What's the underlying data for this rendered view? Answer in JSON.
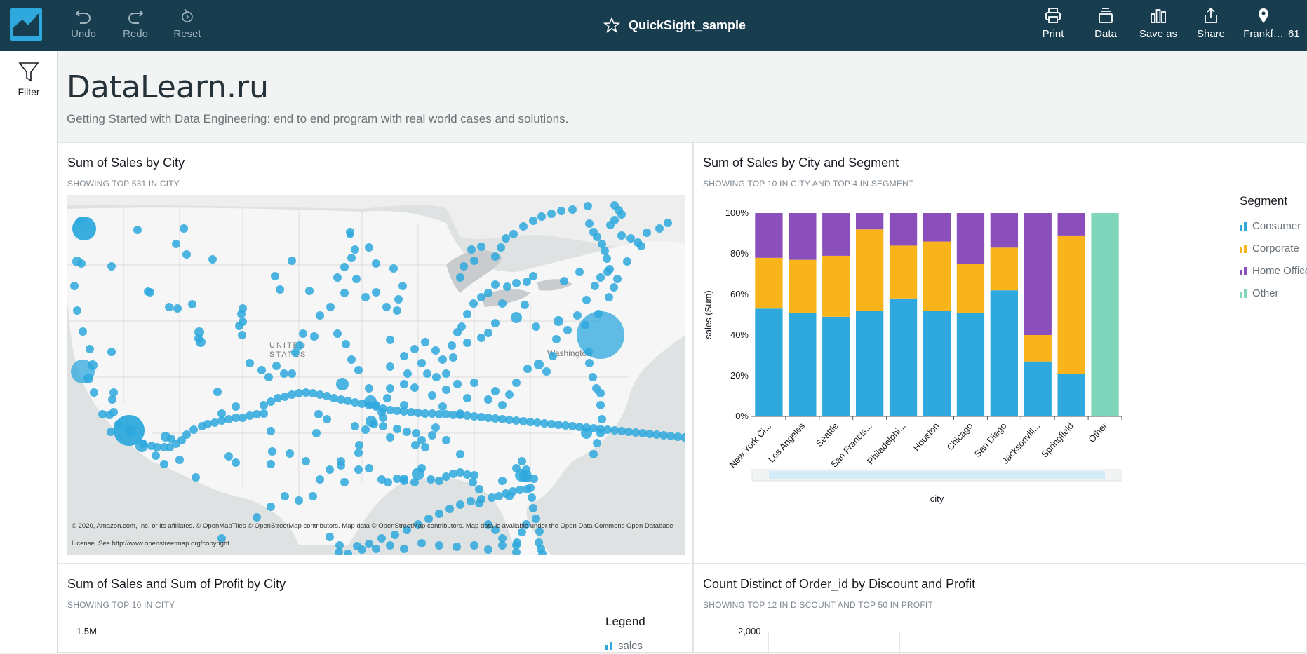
{
  "app": {
    "title": "QuickSight_sample",
    "toolbar_left": [
      {
        "label": "Undo",
        "icon": "undo-icon"
      },
      {
        "label": "Redo",
        "icon": "redo-icon"
      },
      {
        "label": "Reset",
        "icon": "reset-icon"
      }
    ],
    "toolbar_right": [
      {
        "label": "Print",
        "icon": "print-icon"
      },
      {
        "label": "Data",
        "icon": "data-icon"
      },
      {
        "label": "Save as",
        "icon": "save-as-icon"
      },
      {
        "label": "Share",
        "icon": "share-icon"
      },
      {
        "label": "Frankf…",
        "icon": "location-pin-icon"
      },
      {
        "label": "61",
        "icon": ""
      }
    ]
  },
  "sidebar": {
    "filter_label": "Filter"
  },
  "dashboard": {
    "title": "DataLearn.ru",
    "subtitle": "Getting Started with Data Engineering: end to end program with real world cases and solutions."
  },
  "panels": {
    "map": {
      "title": "Sum of Sales by City",
      "subtitle": "SHOWING TOP 531 IN CITY",
      "country_label_1": "UNITED",
      "country_label_2": "STATES",
      "city_label": "Washington",
      "credit": "© 2020, Amazon.com, Inc. or its affiliates. © OpenMapTiles © OpenStreetMap contributors. Map data © OpenStreetMap contributors. Map data is available under the Open Data Commons Open Database License. See http://www.openstreetmap.org/copyright."
    },
    "stacked": {
      "title": "Sum of Sales by City and Segment",
      "subtitle": "SHOWING TOP 10 IN CITY AND TOP 4 IN SEGMENT"
    },
    "bottom_left": {
      "title": "Sum of Sales and Sum of Profit by City",
      "subtitle": "SHOWING TOP 10 IN CITY",
      "y_tick": "1.5M",
      "legend_title": "Legend",
      "legend_first": "sales"
    },
    "bottom_right": {
      "title": "Count Distinct of Order_id by Discount and Profit",
      "subtitle": "SHOWING TOP 12 IN DISCOUNT AND TOP 50 IN PROFIT",
      "y_tick": "2,000"
    }
  },
  "chart_data": {
    "type": "bar",
    "stacked": "percent",
    "xlabel": "city",
    "ylabel": "sales (Sum)",
    "ylim": [
      0,
      100
    ],
    "yticks": [
      "0%",
      "20%",
      "40%",
      "60%",
      "80%",
      "100%"
    ],
    "legend_title": "Segment",
    "legend_position": "right",
    "categories": [
      "New York Ci...",
      "Los Angeles",
      "Seattle",
      "San Francis...",
      "Philadelphi...",
      "Houston",
      "Chicago",
      "San Diego",
      "Jacksonvill...",
      "Springfield",
      "Other"
    ],
    "series": [
      {
        "name": "Consumer",
        "color": "#2ea8dd",
        "values": [
          53,
          51,
          49,
          52,
          58,
          52,
          51,
          62,
          27,
          21,
          0
        ]
      },
      {
        "name": "Corporate",
        "color": "#f9b31b",
        "values": [
          25,
          26,
          30,
          40,
          26,
          34,
          24,
          21,
          13,
          68,
          0
        ]
      },
      {
        "name": "Home Office",
        "color": "#8a4fba",
        "values": [
          22,
          23,
          21,
          8,
          16,
          14,
          25,
          17,
          60,
          11,
          0
        ]
      },
      {
        "name": "Other",
        "color": "#7fd6bb",
        "values": [
          0,
          0,
          0,
          0,
          0,
          0,
          0,
          0,
          0,
          0,
          100
        ]
      }
    ]
  }
}
